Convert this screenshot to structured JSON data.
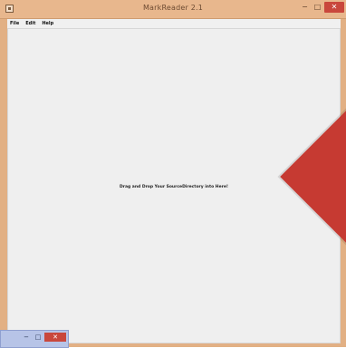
{
  "window": {
    "title": "MarkReader 2.1",
    "controls": {
      "minimize": "−",
      "maximize": "□",
      "close": "✕"
    }
  },
  "menu": [
    {
      "label": "File"
    },
    {
      "label": "Edit"
    },
    {
      "label": "Help"
    }
  ],
  "content": {
    "drop_hint": "Drag and Drop Your SourceDirectory into Here!"
  },
  "mini_window": {
    "controls": {
      "minimize": "−",
      "maximize": "□",
      "close": "✕"
    }
  },
  "colors": {
    "titlebar": "#e8b78d",
    "close_button": "#c9473c",
    "content_bg": "#efefef",
    "red_shape": "#c63a32",
    "mini_window": "#b7c4e7"
  }
}
